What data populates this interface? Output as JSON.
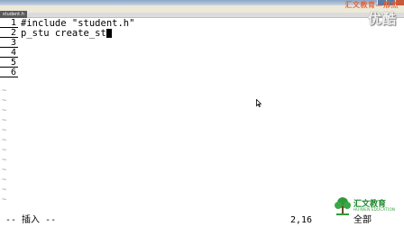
{
  "window": {
    "file_tab": "student.h"
  },
  "watermark": {
    "title": "汇文教育—邢杰",
    "video_logo": "优酷"
  },
  "editor": {
    "lines": [
      {
        "number": "1",
        "text": "#include \"student.h\""
      },
      {
        "number": "2",
        "text": "p_stu create_st"
      },
      {
        "number": "3",
        "text": ""
      },
      {
        "number": "4",
        "text": ""
      },
      {
        "number": "5",
        "text": ""
      },
      {
        "number": "6",
        "text": ""
      }
    ],
    "empty_line_marker": "~"
  },
  "status": {
    "mode": "-- 插入 --",
    "position": "2,16",
    "scroll": "全部"
  },
  "brand": {
    "name": "汇文教育",
    "subtitle": "HUIWEN EDUCATION"
  },
  "colors": {
    "text": "#000000",
    "background": "#ffffff",
    "watermark_orange": "#e85a2a",
    "brand_green": "#1f8a2e"
  }
}
